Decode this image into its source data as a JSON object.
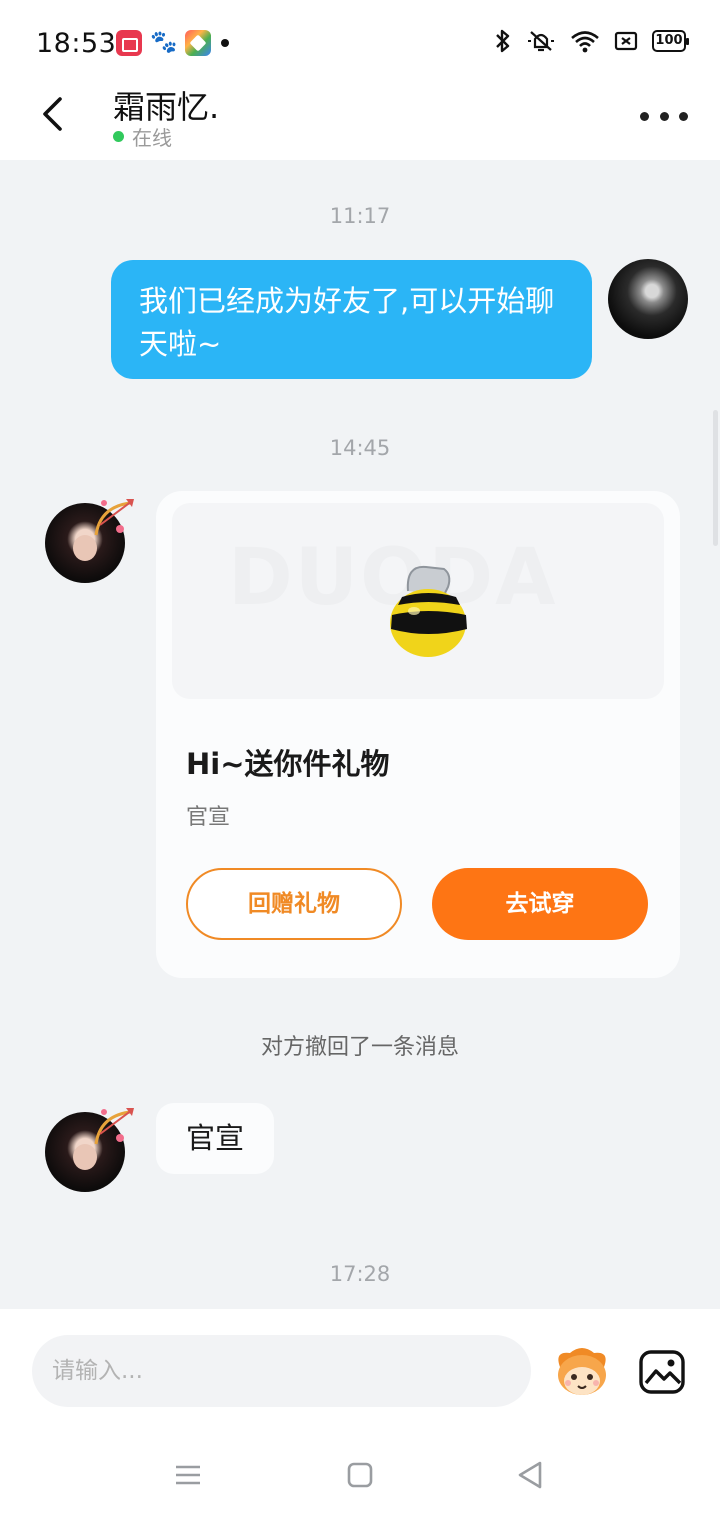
{
  "status_bar": {
    "time": "18:53",
    "battery": "100"
  },
  "header": {
    "contact_name": "霜雨忆.",
    "status": "在线"
  },
  "chat": {
    "timestamps": [
      "11:17",
      "14:45",
      "17:28"
    ],
    "outgoing_message": "我们已经成为好友了,可以开始聊天啦~",
    "gift_card": {
      "watermark": "DUODA",
      "title": "Hi~送你件礼物",
      "subtitle": "官宣",
      "return_button": "回赠礼物",
      "try_button": "去试穿"
    },
    "system_message": "对方撤回了一条消息",
    "incoming_message": "官宣"
  },
  "input_bar": {
    "placeholder": "请输入..."
  },
  "colors": {
    "outgoing_bubble": "#2bb5f6",
    "accent_orange": "#fe7514",
    "online_dot": "#31c95c"
  },
  "icons": {
    "back": "chevron-left-icon",
    "more": "more-dots-icon",
    "emoji": "emoji-face-icon",
    "image": "image-icon",
    "nav_menu": "menu-icon",
    "nav_home": "home-square-icon",
    "nav_back": "triangle-back-icon"
  }
}
